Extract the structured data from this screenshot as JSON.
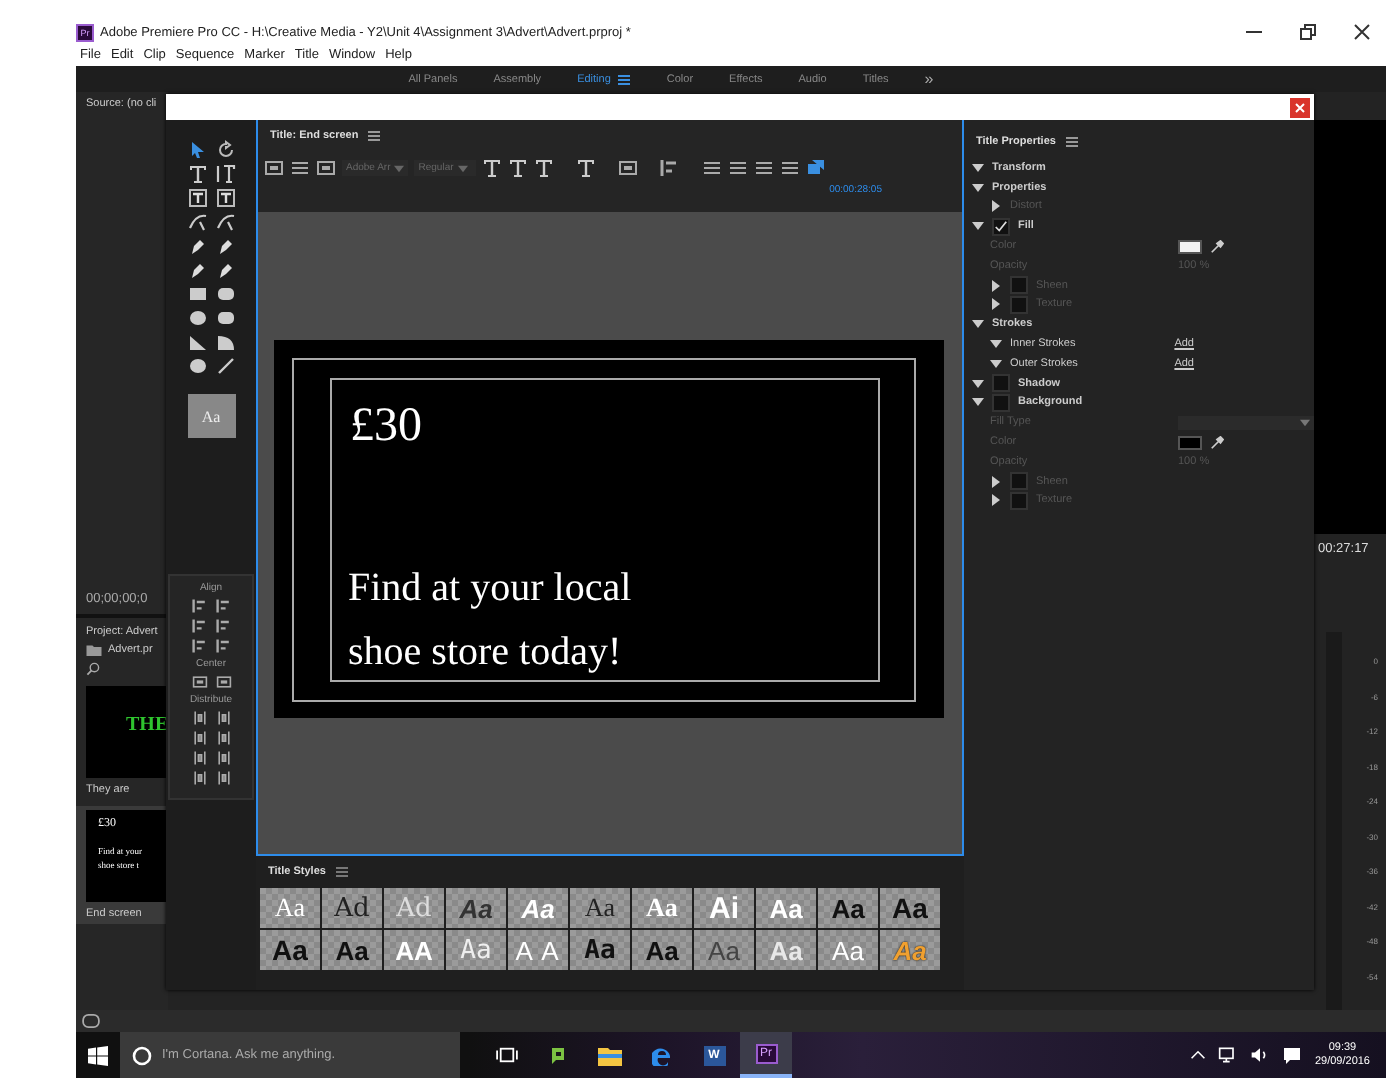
{
  "window": {
    "app_icon": "Pr",
    "title": "Adobe Premiere Pro CC - H:\\Creative Media - Y2\\Unit 4\\Assignment 3\\Advert\\Advert.prproj *"
  },
  "menu": [
    "File",
    "Edit",
    "Clip",
    "Sequence",
    "Marker",
    "Title",
    "Window",
    "Help"
  ],
  "workspaces": [
    {
      "label": "All Panels",
      "selected": false
    },
    {
      "label": "Assembly",
      "selected": false
    },
    {
      "label": "Editing",
      "selected": true
    },
    {
      "label": "Color",
      "selected": false
    },
    {
      "label": "Effects",
      "selected": false
    },
    {
      "label": "Audio",
      "selected": false
    },
    {
      "label": "Titles",
      "selected": false
    }
  ],
  "workspace_more": "»",
  "source_panel": {
    "title": "Source: (no cli",
    "timecode": "00;00;00;0"
  },
  "program_panel": {
    "timecode": "00:27:17"
  },
  "project_panel": {
    "title": "Project: Advert",
    "bin": "Advert.pr",
    "items": [
      {
        "name": "They are",
        "thumb_lines": [
          "THE"
        ],
        "color": "#2fc42f",
        "selected": false
      },
      {
        "name": "End screen",
        "thumb_lines": [
          "£30",
          "Find at your",
          "shoe store t"
        ],
        "color": "#ffffff",
        "selected": true
      }
    ]
  },
  "audio_meter": {
    "ticks": [
      "0",
      "-6",
      "-12",
      "-18",
      "-24",
      "-30",
      "-36",
      "-42",
      "-48",
      "-54"
    ]
  },
  "title_designer": {
    "title": "Title: End screen",
    "font_family": "Adobe Arr",
    "font_style": "Regular",
    "timecode": "00:00:28:05",
    "tool_preview": "Aa",
    "canvas_texts": [
      {
        "lines": [
          "£30"
        ],
        "kind": "price"
      },
      {
        "lines": [
          "Find at your local",
          "shoe store today!"
        ],
        "kind": "body"
      }
    ],
    "align_sections": [
      "Align",
      "Center",
      "Distribute"
    ],
    "styles_title": "Title Styles",
    "styles": [
      [
        "Aa",
        "Ad",
        "Ad",
        "Aa",
        "Aa",
        "Aa",
        "Aa",
        "Ai",
        "Aa",
        "Aa",
        "Aa"
      ],
      [
        "Aa",
        "Aa",
        "AA",
        "Aa",
        "A A",
        "Aa",
        "Aa",
        "Aa",
        "Aa",
        "Aa",
        "Aa"
      ]
    ]
  },
  "properties": {
    "title": "Title Properties",
    "items": [
      {
        "label": "Transform",
        "kind": "group",
        "expanded": true,
        "disabled": false
      },
      {
        "label": "Properties",
        "kind": "group",
        "expanded": true,
        "disabled": false,
        "children": [
          {
            "label": "Distort",
            "kind": "group",
            "expanded": false,
            "disabled": true
          }
        ]
      },
      {
        "label": "Fill",
        "kind": "group",
        "expanded": true,
        "checked": true,
        "disabled": false,
        "children": [
          {
            "label": "Color",
            "kind": "color",
            "color": "#f2f2f2",
            "disabled": true
          },
          {
            "label": "Opacity",
            "kind": "value",
            "value": "100 %",
            "disabled": true
          },
          {
            "label": "Sheen",
            "kind": "group",
            "expanded": false,
            "checked": false,
            "disabled": true
          },
          {
            "label": "Texture",
            "kind": "group",
            "expanded": false,
            "checked": false,
            "disabled": true
          }
        ]
      },
      {
        "label": "Strokes",
        "kind": "group",
        "expanded": true,
        "disabled": false,
        "children": [
          {
            "label": "Inner Strokes",
            "kind": "group",
            "expanded": true,
            "action": "Add",
            "disabled": false
          },
          {
            "label": "Outer Strokes",
            "kind": "group",
            "expanded": true,
            "action": "Add",
            "disabled": false
          }
        ]
      },
      {
        "label": "Shadow",
        "kind": "group",
        "expanded": true,
        "checked": false,
        "disabled": false
      },
      {
        "label": "Background",
        "kind": "group",
        "expanded": true,
        "checked": false,
        "disabled": false,
        "children": [
          {
            "label": "Fill Type",
            "kind": "dropdown",
            "disabled": true
          },
          {
            "label": "Color",
            "kind": "color",
            "color": "#000000",
            "disabled": true
          },
          {
            "label": "Opacity",
            "kind": "value",
            "value": "100 %",
            "disabled": true
          },
          {
            "label": "Sheen",
            "kind": "group",
            "expanded": false,
            "checked": false,
            "disabled": true
          },
          {
            "label": "Texture",
            "kind": "group",
            "expanded": false,
            "checked": false,
            "disabled": true
          }
        ]
      }
    ]
  },
  "taskbar": {
    "search_placeholder": "I'm Cortana. Ask me anything.",
    "time": "09:39",
    "date": "29/09/2016",
    "apps": [
      {
        "kind": "task-view",
        "selected": false
      },
      {
        "kind": "publisher",
        "selected": false
      },
      {
        "kind": "explorer",
        "selected": false
      },
      {
        "kind": "edge",
        "selected": false
      },
      {
        "kind": "word",
        "label": "W",
        "selected": false
      },
      {
        "kind": "premiere",
        "label": "Pr",
        "selected": true
      }
    ]
  }
}
